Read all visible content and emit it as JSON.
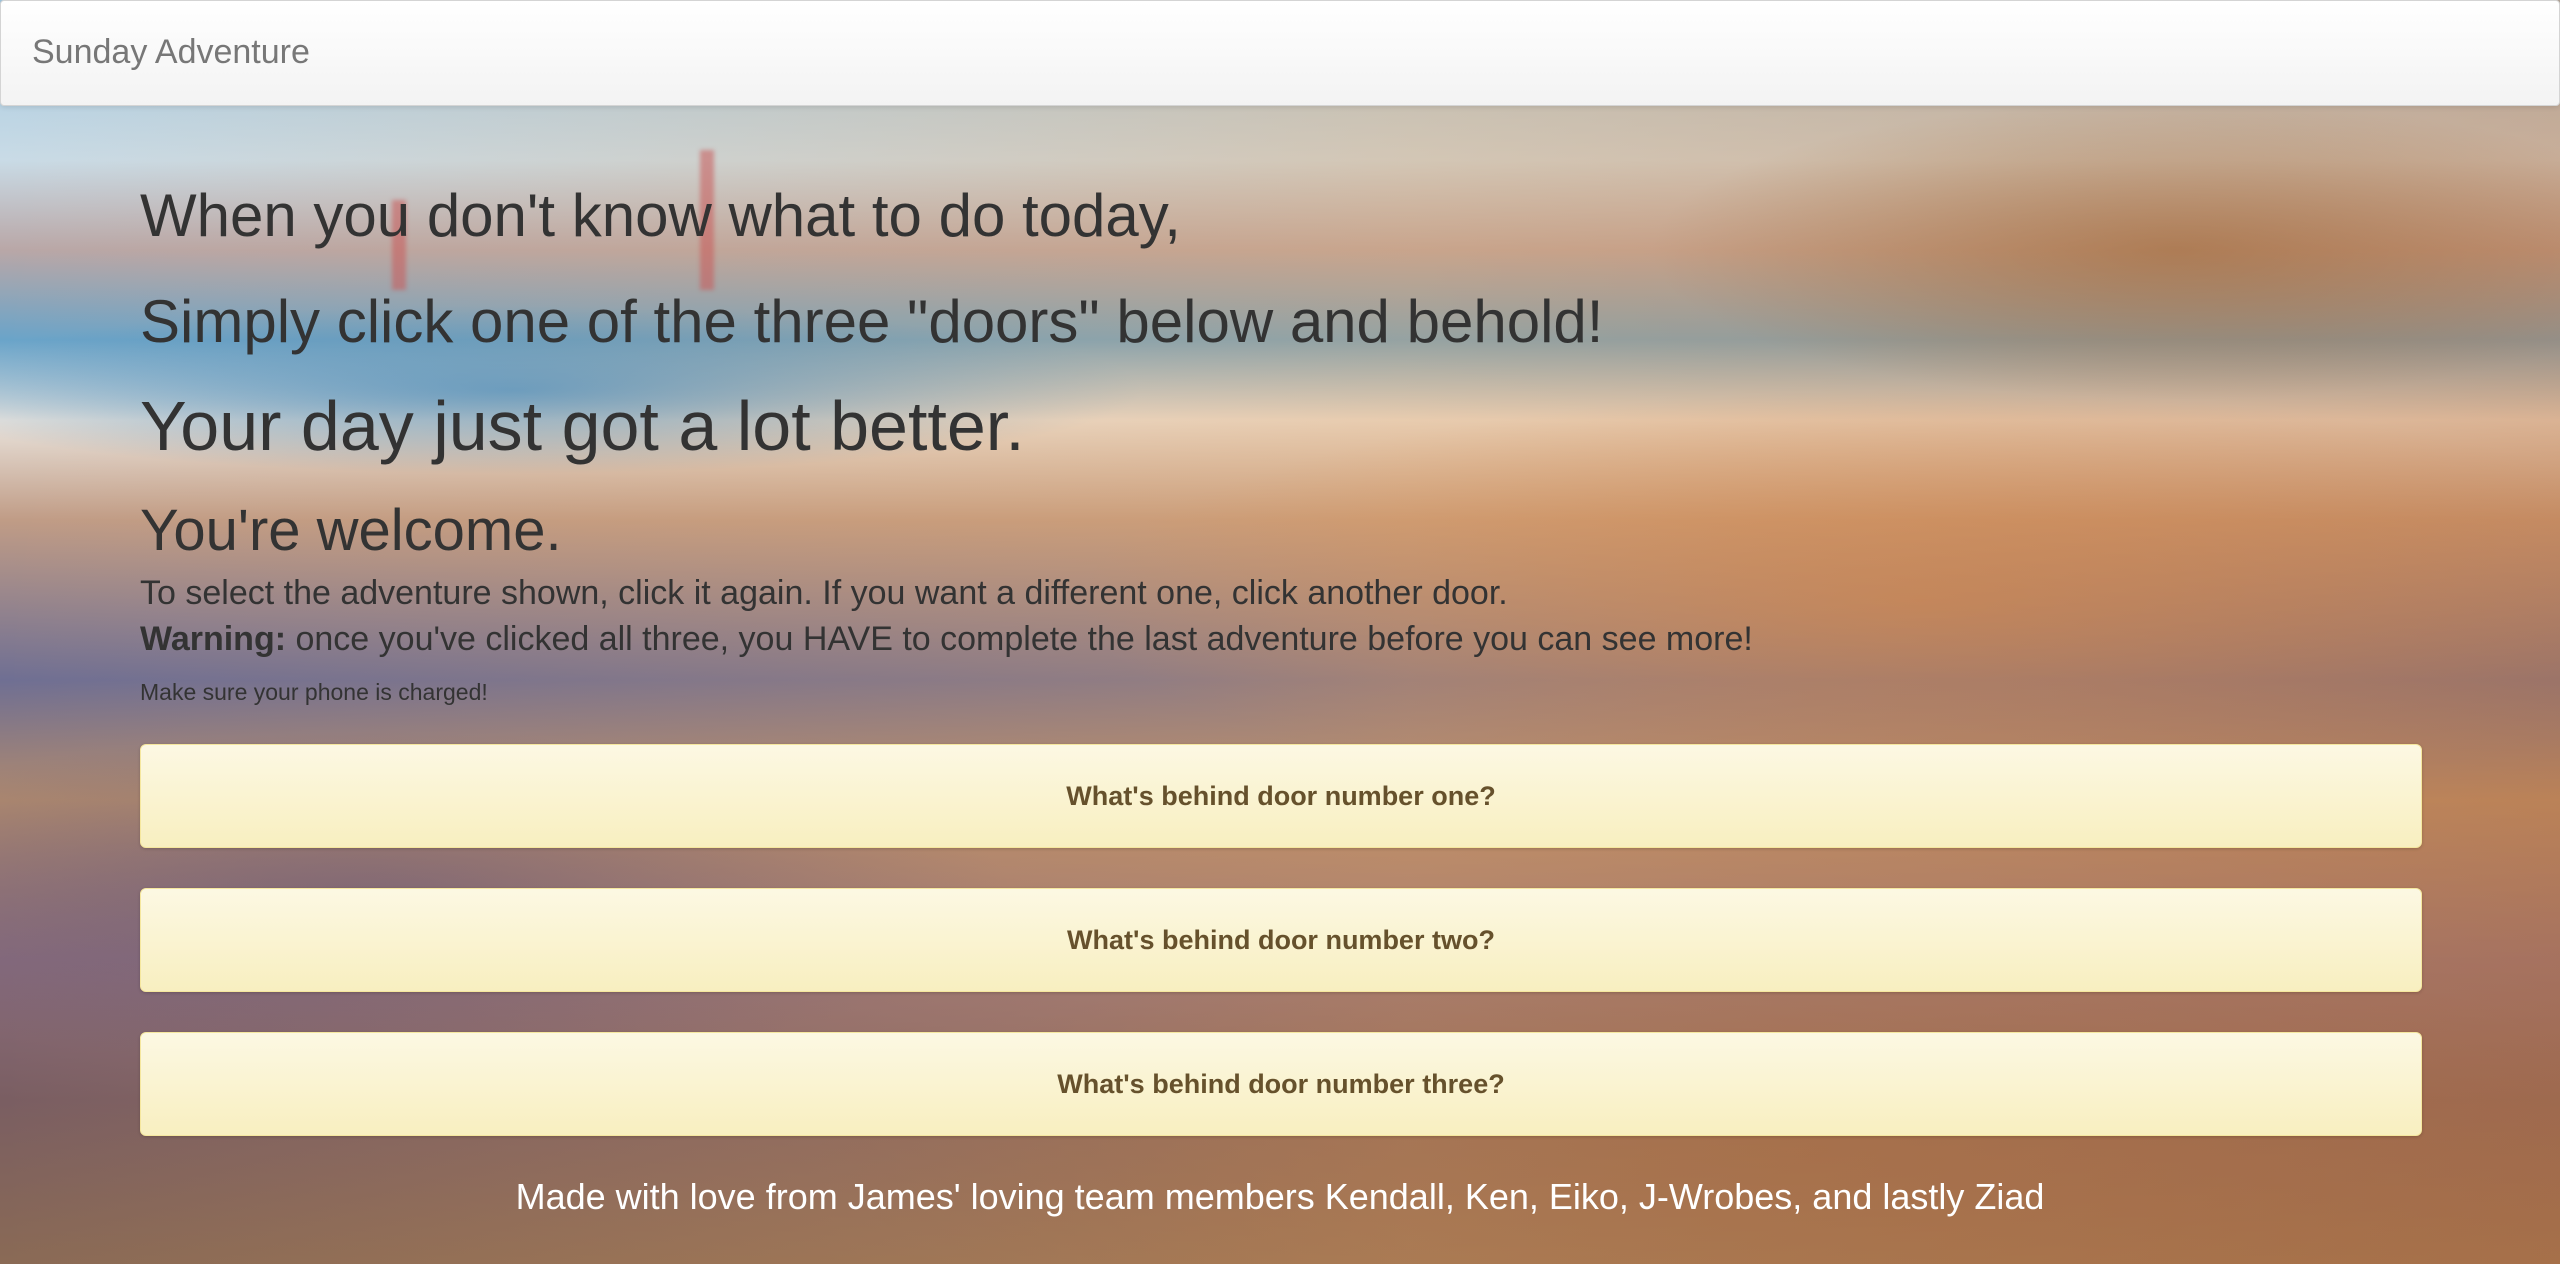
{
  "navbar": {
    "brand": "Sunday Adventure"
  },
  "intro": {
    "line1": "When you don't know what to do today,",
    "line2": "Simply click one of the three \"doors\" below and behold!",
    "line3": "Your day just got a lot better.",
    "line4": "You're welcome.",
    "instruction": "To select the adventure shown, click it again. If you want a different one, click another door.",
    "warning_label": "Warning:",
    "warning_text": " once you've clicked all three, you HAVE to complete the last adventure before you can see more!",
    "note": "Make sure your phone is charged!"
  },
  "doors": [
    {
      "label": "What's behind door number one?"
    },
    {
      "label": "What's behind door number two?"
    },
    {
      "label": "What's behind door number three?"
    }
  ],
  "footer": {
    "text": "Made with love from James' loving team members Kendall, Ken, Eiko, J-Wrobes, and lastly Ziad"
  },
  "colors": {
    "door_bg": "#fcf8e3",
    "door_text": "#66512c",
    "heading_text": "#333333",
    "brand_text": "#777777"
  }
}
